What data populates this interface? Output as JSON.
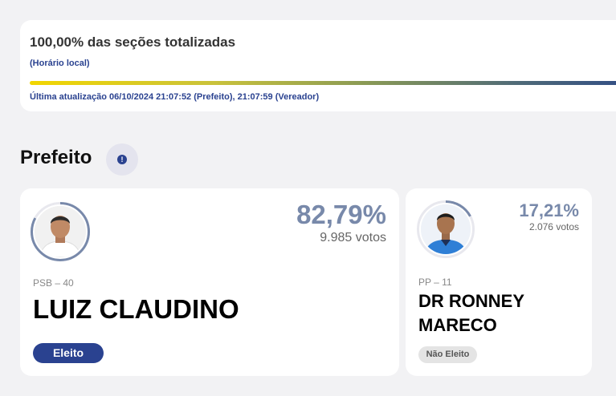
{
  "status": {
    "title": "100,00% das seções totalizadas",
    "subtitle": "(Horário local)",
    "progress_fraction": 1.0,
    "last_update": "Última atualização 06/10/2024 21:07:52 (Prefeito), 21:07:59 (Vereador)"
  },
  "section": {
    "title": "Prefeito",
    "info_icon": "info-icon"
  },
  "candidates": [
    {
      "percent": "82,79%",
      "votes": "9.985 votos",
      "party": "PSB – 40",
      "name": "LUIZ CLAUDINO",
      "status": "Eleito",
      "vote_share": 0.8279
    },
    {
      "percent": "17,21%",
      "votes": "2.076 votos",
      "party": "PP – 11",
      "name_line1": "DR RONNEY",
      "name_line2": "MARECO",
      "status": "Não Eleito",
      "vote_share": 0.1721
    }
  ],
  "colors": {
    "accent": "#2a4290",
    "percent": "#7889aa",
    "progress_start": "#f2d600",
    "progress_end": "#2e4a86",
    "background": "#f2f2f4"
  }
}
